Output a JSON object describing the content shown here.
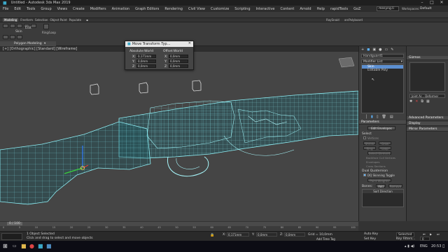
{
  "window": {
    "title": "Untitled - Autodesk 3ds Max 2019"
  },
  "menu": [
    "File",
    "Edit",
    "Tools",
    "Group",
    "Views",
    "Create",
    "Modifiers",
    "Animation",
    "Graph Editors",
    "Rendering",
    "Civil View",
    "Customize",
    "Scripting",
    "Interactive",
    "Content",
    "Arnold",
    "Help",
    "rapidTools",
    "GoZ"
  ],
  "header_right": {
    "user": "mesyng.li",
    "workspaces_label": "Workspaces:",
    "workspace": "Default"
  },
  "toolbar": {
    "selection_set": "Create Selection Se",
    "view": "View"
  },
  "toolbar2": [
    "Modeling",
    "Freeform",
    "Selection",
    "Object Paint",
    "Populate"
  ],
  "toolbar2_right": [
    "RaySnaid",
    "arcPolyboard"
  ],
  "ribbon": {
    "section": "Polygon Modeling",
    "edit": "Edit",
    "ring_loop": "Ring/Loop"
  },
  "viewport": {
    "label": "[+] [Orthographic] [Standard] [Wireframe]"
  },
  "dialog": {
    "title": "Move Transform Typ...",
    "abs_title": "Absolute:World",
    "off_title": "Offset:World",
    "abs": [
      {
        "axis": "X:",
        "value": "0,171mm"
      },
      {
        "axis": "Y:",
        "value": "0,0mm"
      },
      {
        "axis": "Z:",
        "value": "0,0mm"
      }
    ],
    "off": [
      {
        "axis": "X:",
        "value": "0,0mm"
      },
      {
        "axis": "Y:",
        "value": "0,0mm"
      },
      {
        "axis": "Z:",
        "value": "0,0mm"
      }
    ]
  },
  "command_panel": {
    "object_name": "Handguard1",
    "modifier_list": "Modifier List",
    "stack": [
      "Skin",
      "Editable Poly"
    ],
    "parameters": "Parameters",
    "edit_envelopes": "Edit Envelopes",
    "select": "Select",
    "select_options": [
      "Vertices",
      "Shrink",
      "Grow",
      "Ring",
      "Loop",
      "Select Element",
      "Backface Cull Vertices",
      "Envelopes",
      "Cross Sections"
    ],
    "dual_quaternion": "Dual Quaternion",
    "dq_toggle": "DQ Skinning Toggle",
    "paint_weights": "Paint Weights",
    "bones": "Bones:",
    "add": "Add",
    "remove": "Remove",
    "sort_direction": "Sort Direction"
  },
  "right_panel": {
    "gizmos": "Gizmos",
    "joint_deformer": "Joint Ar... Deformer",
    "advanced": "Advanced Parameters",
    "display": "Display",
    "mirror": "Mirror Parameters"
  },
  "timeline": {
    "frame": "0 / 100",
    "ticks": [
      "0",
      "5",
      "10",
      "15",
      "20",
      "25",
      "30",
      "35",
      "40",
      "45",
      "50",
      "55",
      "60",
      "65",
      "70",
      "75",
      "80",
      "85",
      "90",
      "95",
      "100"
    ]
  },
  "status": {
    "objects": "1 Object Selected",
    "prompt": "Click and drag to select and move objects",
    "x_value": "0,171mm",
    "y_value": "0,0mm",
    "z_value": "0,0mm",
    "grid": "Grid = 10,0mm",
    "add_time_tag": "Add Time Tag",
    "auto_key": "Auto Key",
    "selected": "Selected",
    "set_key": "Set Key",
    "key_filters": "Key Filters...",
    "frame_value": "0"
  },
  "taskbar": {
    "lang": "ENG",
    "time": "20:53"
  }
}
